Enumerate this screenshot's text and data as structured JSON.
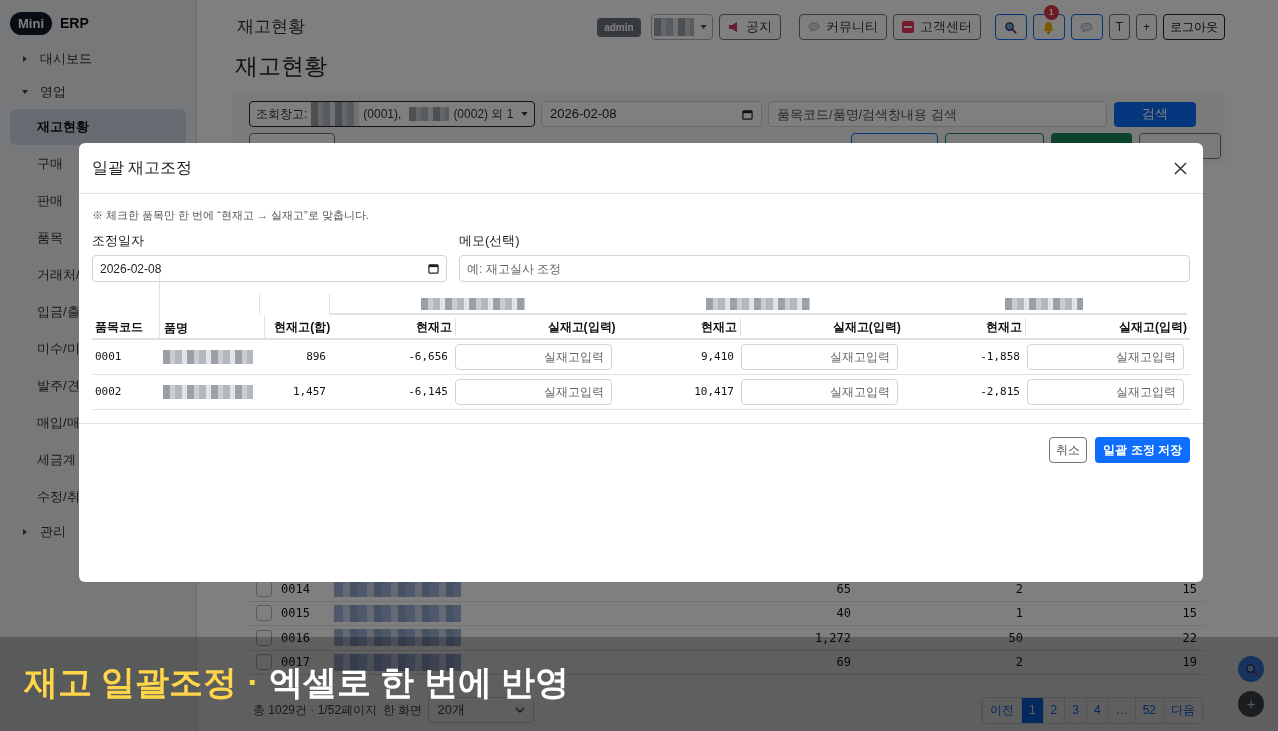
{
  "sidebar": {
    "logo": {
      "badge": "Mini",
      "text": "ERP"
    },
    "items": [
      {
        "label": "대시보드",
        "expanded": false
      },
      {
        "label": "영업",
        "expanded": true,
        "children": [
          {
            "label": "재고현황",
            "selected": true
          },
          {
            "label": "구매",
            "selected": false
          },
          {
            "label": "판매",
            "selected": false
          },
          {
            "label": "품목",
            "selected": false
          },
          {
            "label": "거래처/",
            "selected": false
          },
          {
            "label": "입금/출",
            "selected": false
          },
          {
            "label": "미수/미",
            "selected": false
          },
          {
            "label": "발주/견",
            "selected": false
          },
          {
            "label": "매입/매",
            "selected": false
          },
          {
            "label": "세금계",
            "selected": false
          },
          {
            "label": "수정/취",
            "selected": false
          }
        ]
      },
      {
        "label": "관리",
        "expanded": false
      }
    ]
  },
  "header": {
    "breadcrumb": "재고현황",
    "title": "재고현황",
    "role_badge": "admin",
    "buttons": [
      {
        "kind": "notice",
        "label": "공지"
      },
      {
        "kind": "community",
        "label": "커뮤니티"
      },
      {
        "kind": "support",
        "label": "고객센터"
      }
    ],
    "icon_buttons": [
      {
        "kind": "search"
      },
      {
        "kind": "bell",
        "badge": "1"
      },
      {
        "kind": "chat"
      },
      {
        "kind": "text",
        "label": "T"
      },
      {
        "kind": "text",
        "label": "+"
      }
    ],
    "logout": "로그아웃"
  },
  "filters": {
    "warehouse_label": "조회창고:",
    "warehouse_codes": [
      "(0001),",
      "(0002) 외 1"
    ],
    "date": "2026-02-08",
    "search_placeholder": "품목코드/품명/검색창내용 검색",
    "search_button": "검색"
  },
  "table": {
    "rows": [
      {
        "checked": false,
        "code": "0014",
        "values": [
          "65",
          "2",
          "15"
        ]
      },
      {
        "checked": false,
        "code": "0015",
        "values": [
          "40",
          "1",
          "15"
        ]
      },
      {
        "checked": false,
        "code": "0016",
        "values": [
          "1,272",
          "50",
          "22"
        ]
      },
      {
        "checked": false,
        "code": "0017",
        "values": [
          "69",
          "2",
          "19"
        ]
      }
    ]
  },
  "footer": {
    "summary": "총 1029건 · 1/52페이지",
    "per_page_label": "한 화면",
    "per_page": "20개",
    "pages": [
      {
        "label": "이전",
        "selected": false
      },
      {
        "label": "1",
        "selected": true
      },
      {
        "label": "2",
        "selected": false
      },
      {
        "label": "3",
        "selected": false
      },
      {
        "label": "4",
        "selected": false
      },
      {
        "label": "…",
        "selected": false
      },
      {
        "label": "52",
        "selected": false
      },
      {
        "label": "다음",
        "selected": false
      }
    ]
  },
  "floating": [
    {
      "kind": "search"
    },
    {
      "kind": "text",
      "label": "+"
    }
  ],
  "modal": {
    "title": "일괄 재고조정",
    "note": "※ 체크한 품목만 한 번에 “현재고 → 실재고”로 맞춥니다.",
    "date_label": "조정일자",
    "date": "2026-02-08",
    "memo_label": "메모(선택)",
    "memo_placeholder": "예: 재고실사 조정",
    "columns": {
      "code": "품목코드",
      "name": "품명",
      "total": "현재고(합)"
    },
    "warehouses": [
      {
        "current_label": "현재고",
        "actual_label": "실재고(입력)"
      },
      {
        "current_label": "현재고",
        "actual_label": "실재고(입력)"
      },
      {
        "current_label": "현재고",
        "actual_label": "실재고(입력)"
      }
    ],
    "rows": [
      {
        "code": "0001",
        "total": "896",
        "stocks": [
          {
            "current": "-6,656",
            "placeholder": "실재고입력"
          },
          {
            "current": "9,410",
            "placeholder": "실재고입력"
          },
          {
            "current": "-1,858",
            "placeholder": "실재고입력"
          }
        ]
      },
      {
        "code": "0002",
        "total": "1,457",
        "stocks": [
          {
            "current": "-6,145",
            "placeholder": "실재고입력"
          },
          {
            "current": "10,417",
            "placeholder": "실재고입력"
          },
          {
            "current": "-2,815",
            "placeholder": "실재고입력"
          }
        ]
      }
    ],
    "cancel": "취소",
    "save": "일괄 조정 저장"
  },
  "caption": {
    "highlight": "재고 일괄조정",
    "separator": "·",
    "text": "엑셀로 한 번에 반영"
  }
}
